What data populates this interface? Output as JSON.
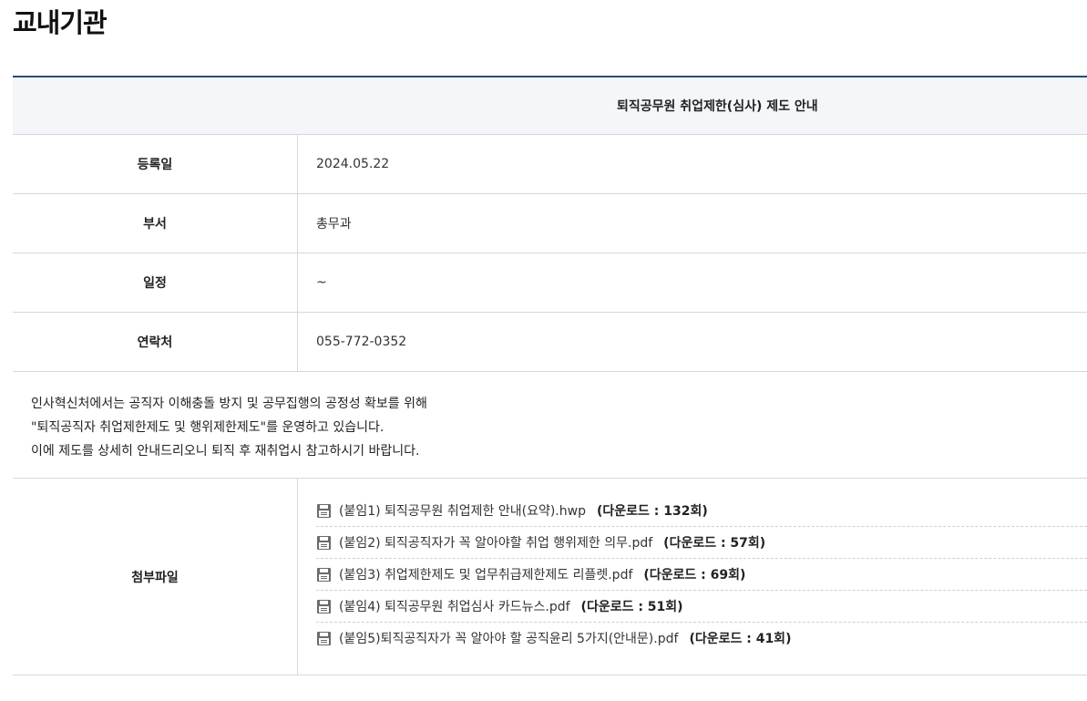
{
  "page": {
    "title": "교내기관"
  },
  "post": {
    "title": "퇴직공무원 취업제한(심사) 제도 안내",
    "rows": [
      {
        "label": "등록일",
        "value": "2024.05.22"
      },
      {
        "label": "부서",
        "value": "총무과"
      },
      {
        "label": "일정",
        "value": "~"
      },
      {
        "label": "연락처",
        "value": "055-772-0352"
      }
    ],
    "body": [
      "인사혁신처에서는 공직자 이해충돌 방지 및 공무집행의 공정성 확보를 위해",
      "\"퇴직공직자 취업제한제도 및 행위제한제도\"를 운영하고 있습니다.",
      "이에 제도를 상세히 안내드리오니 퇴직 후 재취업시 참고하시기 바랍니다."
    ],
    "attachments_label": "첨부파일",
    "attachments": [
      {
        "name": "(붙임1) 퇴직공무원 취업제한 안내(요약).hwp",
        "downloads": "(다운로드 : 132회)"
      },
      {
        "name": "(붙임2) 퇴직공직자가 꼭 알아야할 취업 행위제한 의무.pdf",
        "downloads": "(다운로드 : 57회)"
      },
      {
        "name": "(붙임3) 취업제한제도 및 업무취급제한제도 리플렛.pdf",
        "downloads": "(다운로드 : 69회)"
      },
      {
        "name": "(붙임4) 퇴직공무원 취업심사 카드뉴스.pdf",
        "downloads": "(다운로드 : 51회)"
      },
      {
        "name": "(붙임5)퇴직공직자가 꼭 알아야 할 공직윤리 5가지(안내문).pdf",
        "downloads": "(다운로드 : 41회)"
      }
    ],
    "icons": {
      "attachment": "file-document-icon"
    },
    "colors": {
      "accent_border": "#1f4e79",
      "title_row_bg": "#f4f6f9"
    }
  }
}
